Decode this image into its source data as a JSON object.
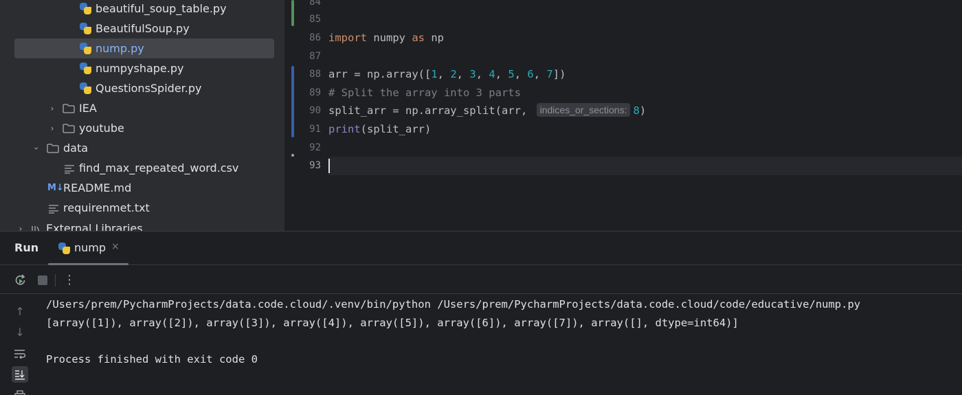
{
  "project_tree": {
    "items": [
      {
        "label": "beautiful_soup_table.py",
        "type": "python-file"
      },
      {
        "label": "BeautifulSoup.py",
        "type": "python-file"
      },
      {
        "label": "nump.py",
        "type": "python-file",
        "selected": true
      },
      {
        "label": "numpyshape.py",
        "type": "python-file"
      },
      {
        "label": "QuestionsSpider.py",
        "type": "python-file"
      },
      {
        "label": "IEA",
        "type": "folder",
        "expanded": false
      },
      {
        "label": "youtube",
        "type": "folder",
        "expanded": false
      },
      {
        "label": "data",
        "type": "folder",
        "expanded": true
      },
      {
        "label": "find_max_repeated_word.csv",
        "type": "text-file"
      },
      {
        "label": "README.md",
        "type": "markdown-file",
        "icon_text": "M↓"
      },
      {
        "label": "requirenmet.txt",
        "type": "text-file"
      },
      {
        "label": "External Libraries",
        "type": "library",
        "expanded": false
      }
    ]
  },
  "editor": {
    "line_numbers": [
      "84",
      "85",
      "86",
      "87",
      "88",
      "89",
      "90",
      "91",
      "92",
      "93"
    ],
    "current_line": "93",
    "lines": {
      "l86": {
        "kw1": "import",
        "t1": " numpy ",
        "kw2": "as",
        "t2": " np"
      },
      "l88": {
        "t1": "arr = np.array([",
        "n1": "1",
        "s1": ", ",
        "n2": "2",
        "s2": ", ",
        "n3": "3",
        "s3": ", ",
        "n4": "4",
        "s4": ", ",
        "n5": "5",
        "s5": ", ",
        "n6": "6",
        "s6": ", ",
        "n7": "7",
        "t2": "])"
      },
      "l89": {
        "comment": "# Split the array into 3 parts"
      },
      "l90": {
        "t1": "split_arr = np.array_split(arr, ",
        "hint": "indices_or_sections:",
        "n1": "8",
        "t2": ")"
      },
      "l91": {
        "fn": "print",
        "t1": "(split_arr)"
      }
    }
  },
  "run_panel": {
    "title": "Run",
    "tab_label": "nump",
    "tab_close": "×",
    "console_lines": [
      "/Users/prem/PycharmProjects/data.code.cloud/.venv/bin/python /Users/prem/PycharmProjects/data.code.cloud/code/educative/nump.py",
      "[array([1]), array([2]), array([3]), array([4]), array([5]), array([6]), array([7]), array([], dtype=int64)]",
      "",
      "Process finished with exit code 0"
    ]
  },
  "colors": {
    "panel_bg": "#2b2d30",
    "editor_bg": "#1e1f22",
    "keyword": "#cf8e6d",
    "number": "#2aacb8",
    "comment": "#7a7e85",
    "builtin": "#8888c6",
    "selected_file": "#89b4f5",
    "vcs_added": "#549159",
    "vcs_modified": "#375fad"
  }
}
